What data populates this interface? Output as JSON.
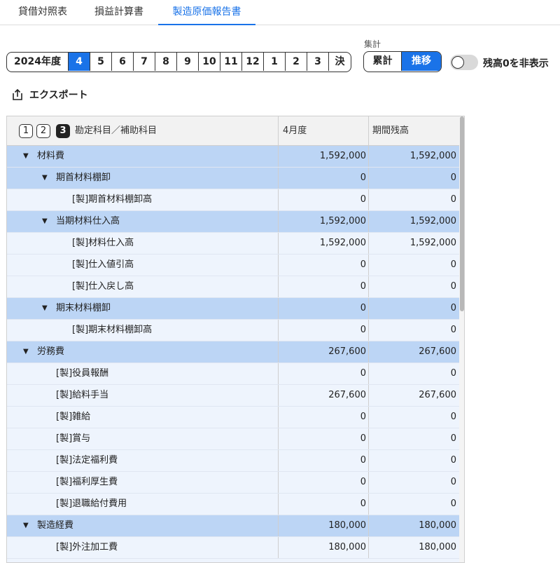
{
  "tabs": [
    {
      "label": "貸借対照表",
      "active": false
    },
    {
      "label": "損益計算書",
      "active": false
    },
    {
      "label": "製造原価報告書",
      "active": true
    }
  ],
  "period": {
    "year_label": "2024年度",
    "months": [
      "4",
      "5",
      "6",
      "7",
      "8",
      "9",
      "10",
      "11",
      "12",
      "1",
      "2",
      "3",
      "決"
    ],
    "selected": "4"
  },
  "aggregation": {
    "label": "集計",
    "options": [
      "累計",
      "推移"
    ],
    "selected": "推移"
  },
  "zero_toggle": {
    "label": "残高0を非表示",
    "on": false
  },
  "export": {
    "label": "エクスポート",
    "icon": "export-icon"
  },
  "table": {
    "level_buttons": [
      "1",
      "2",
      "3"
    ],
    "active_level": "3",
    "columns": [
      "勘定科目／補助科目",
      "4月度",
      "期間残高"
    ],
    "rows": [
      {
        "name": "材料費",
        "level": 0,
        "expandable": true,
        "v1": "1,592,000",
        "v2": "1,592,000"
      },
      {
        "name": "期首材料棚卸",
        "level": 1,
        "expandable": true,
        "v1": "0",
        "v2": "0"
      },
      {
        "name": "[製]期首材料棚卸高",
        "level": 2,
        "expandable": false,
        "v1": "0",
        "v2": "0"
      },
      {
        "name": "当期材料仕入高",
        "level": 1,
        "expandable": true,
        "v1": "1,592,000",
        "v2": "1,592,000"
      },
      {
        "name": "[製]材料仕入高",
        "level": 2,
        "expandable": false,
        "v1": "1,592,000",
        "v2": "1,592,000"
      },
      {
        "name": "[製]仕入値引高",
        "level": 2,
        "expandable": false,
        "v1": "0",
        "v2": "0"
      },
      {
        "name": "[製]仕入戻し高",
        "level": 2,
        "expandable": false,
        "v1": "0",
        "v2": "0"
      },
      {
        "name": "期末材料棚卸",
        "level": 1,
        "expandable": true,
        "v1": "0",
        "v2": "0"
      },
      {
        "name": "[製]期末材料棚卸高",
        "level": 2,
        "expandable": false,
        "v1": "0",
        "v2": "0"
      },
      {
        "name": "労務費",
        "level": 0,
        "expandable": true,
        "v1": "267,600",
        "v2": "267,600"
      },
      {
        "name": "[製]役員報酬",
        "level": 1,
        "expandable": false,
        "v1": "0",
        "v2": "0"
      },
      {
        "name": "[製]給料手当",
        "level": 1,
        "expandable": false,
        "v1": "267,600",
        "v2": "267,600"
      },
      {
        "name": "[製]雑給",
        "level": 1,
        "expandable": false,
        "v1": "0",
        "v2": "0"
      },
      {
        "name": "[製]賞与",
        "level": 1,
        "expandable": false,
        "v1": "0",
        "v2": "0"
      },
      {
        "name": "[製]法定福利費",
        "level": 1,
        "expandable": false,
        "v1": "0",
        "v2": "0"
      },
      {
        "name": "[製]福利厚生費",
        "level": 1,
        "expandable": false,
        "v1": "0",
        "v2": "0"
      },
      {
        "name": "[製]退職給付費用",
        "level": 1,
        "expandable": false,
        "v1": "0",
        "v2": "0"
      },
      {
        "name": "製造経費",
        "level": 0,
        "expandable": true,
        "v1": "180,000",
        "v2": "180,000"
      },
      {
        "name": "[製]外注加工費",
        "level": 1,
        "expandable": false,
        "v1": "180,000",
        "v2": "180,000"
      }
    ]
  },
  "colors": {
    "accent": "#1a73e8",
    "group_row": "#bcd5f5",
    "item_row": "#eef4fd"
  }
}
